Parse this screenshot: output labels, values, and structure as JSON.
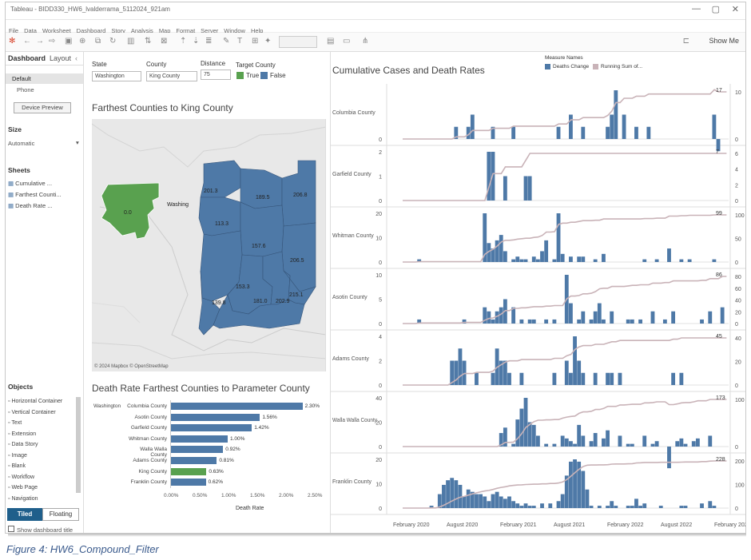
{
  "window": {
    "title": "Tableau - BIDD330_HW6_lvalderrama_5112024_921am",
    "controls": [
      "—",
      "▢",
      "✕"
    ]
  },
  "menu": [
    "File",
    "Data",
    "Worksheet",
    "Dashboard",
    "Story",
    "Analysis",
    "Map",
    "Format",
    "Server",
    "Window",
    "Help"
  ],
  "toolbar": {
    "show_me": "Show Me"
  },
  "left": {
    "tabs": [
      "Dashboard",
      "Layout"
    ],
    "devices": [
      "Default",
      "Phone"
    ],
    "device_preview": "Device Preview",
    "size_head": "Size",
    "size_value": "Automatic",
    "sheets_head": "Sheets",
    "sheets": [
      "Cumulative ...",
      "Farthest Counti...",
      "Death Rate ..."
    ],
    "objects_head": "Objects",
    "objects": [
      "Horizontal Container",
      "Vertical Container",
      "Text",
      "Extension",
      "Data Story",
      "Image",
      "Blank",
      "Workflow",
      "Web Page",
      "Navigation"
    ],
    "tiled": "Tiled",
    "floating": "Floating",
    "show_title": "Show dashboard title"
  },
  "filters": {
    "state_label": "State",
    "state_value": "Washington",
    "county_label": "County",
    "county_value": "King County",
    "distance_label": "Distance",
    "distance_value": "75",
    "target_label": "Target County",
    "true_label": "True",
    "false_label": "False"
  },
  "colors": {
    "blue": "#4e79a7",
    "green": "#59a14f",
    "line": "#c9b3b8"
  },
  "map": {
    "title": "Farthest Counties to King County",
    "attribution": "© 2024 Mapbox © OpenStreetMap",
    "city_label": "Washing",
    "values": [
      "0.0",
      "201.3",
      "189.5",
      "206.8",
      "113.3",
      "157.6",
      "206.5",
      "153.3",
      "139.8",
      "181.0",
      "202.9",
      "215.1"
    ]
  },
  "bar_chart": {
    "title": "Death Rate Farthest Counties to Parameter County",
    "state": "Washington",
    "xlabel": "Death Rate",
    "ticks": [
      "0.00%",
      "0.50%",
      "1.00%",
      "1.50%",
      "2.00%",
      "2.50%"
    ],
    "rows": [
      {
        "county": "Columbia County",
        "value": 2.3,
        "label": "2.30%",
        "target": false
      },
      {
        "county": "Asotin County",
        "value": 1.56,
        "label": "1.56%",
        "target": false
      },
      {
        "county": "Garfield County",
        "value": 1.42,
        "label": "1.42%",
        "target": false
      },
      {
        "county": "Whitman County",
        "value": 1.0,
        "label": "1.00%",
        "target": false
      },
      {
        "county": "Walla Walla County",
        "value": 0.92,
        "label": "0.92%",
        "target": false
      },
      {
        "county": "Adams County",
        "value": 0.81,
        "label": "0.81%",
        "target": false
      },
      {
        "county": "King County",
        "value": 0.63,
        "label": "0.63%",
        "target": true
      },
      {
        "county": "Franklin County",
        "value": 0.62,
        "label": "0.62%",
        "target": false
      }
    ]
  },
  "chart_data": {
    "type": "bar",
    "title": "Cumulative Cases and Death Rates",
    "legend_title": "Measure Names",
    "legend": [
      "Deaths Change",
      "Running Sum of..."
    ],
    "x_ticks": [
      "February 2020",
      "August 2020",
      "February 2021",
      "August 2021",
      "February 2022",
      "August 2022",
      "February 2023"
    ],
    "panels": [
      {
        "county": "Columbia County",
        "left_ticks": [
          "0"
        ],
        "right_ticks": [
          "10",
          "0"
        ],
        "right_max": 20,
        "end_label": "17",
        "bars": [
          0,
          0,
          0,
          0,
          0,
          0,
          0,
          0,
          0,
          0,
          0,
          1,
          0,
          0,
          1,
          2,
          0,
          0,
          0,
          0,
          1,
          0,
          0,
          0,
          0,
          1,
          0,
          0,
          0,
          0,
          0,
          0,
          0,
          0,
          0,
          0,
          1,
          0,
          0,
          2,
          0,
          0,
          1,
          0,
          0,
          0,
          0,
          0,
          1,
          2,
          4,
          0,
          2,
          0,
          0,
          1,
          0,
          0,
          1,
          0,
          0,
          0,
          0,
          0,
          0,
          0,
          0,
          0,
          0,
          0,
          0,
          0,
          0,
          0,
          2,
          -1,
          0,
          0
        ]
      },
      {
        "county": "Garfield County",
        "left_ticks": [
          "2",
          "1",
          "0"
        ],
        "right_ticks": [
          "6",
          "4",
          "2",
          "0"
        ],
        "right_max": 7,
        "end_label": "7",
        "bars": [
          0,
          0,
          0,
          0,
          0,
          0,
          0,
          0,
          0,
          0,
          0,
          0,
          0,
          0,
          0,
          0,
          0,
          0,
          0,
          2,
          2,
          0,
          0,
          1,
          0,
          0,
          0,
          0,
          1,
          1,
          0,
          0,
          0,
          0,
          0,
          0,
          0,
          0,
          0,
          0,
          0,
          0,
          0,
          0,
          0,
          0,
          0,
          0,
          0,
          0,
          0,
          0,
          0,
          0,
          0,
          0,
          0,
          0,
          0,
          0,
          0,
          0,
          0,
          0,
          0,
          0,
          0,
          0,
          0,
          0,
          0,
          0,
          0,
          0,
          0,
          0,
          0,
          0
        ]
      },
      {
        "county": "Whitman County",
        "left_ticks": [
          "20",
          "10",
          "0"
        ],
        "right_ticks": [
          "100",
          "50",
          "0"
        ],
        "right_max": 100,
        "end_label": "99",
        "bars": [
          0,
          0,
          1,
          0,
          0,
          0,
          0,
          0,
          0,
          0,
          0,
          0,
          0,
          0,
          0,
          0,
          0,
          0,
          18,
          7,
          5,
          8,
          10,
          4,
          0,
          1,
          2,
          1,
          1,
          0,
          2,
          1,
          4,
          8,
          0,
          1,
          18,
          3,
          0,
          2,
          0,
          2,
          2,
          0,
          0,
          1,
          0,
          3,
          0,
          0,
          0,
          0,
          0,
          0,
          0,
          0,
          0,
          1,
          0,
          0,
          1,
          0,
          0,
          5,
          0,
          0,
          1,
          0,
          1,
          0,
          0,
          0,
          0,
          0,
          1,
          0,
          0,
          0
        ]
      },
      {
        "county": "Asotin County",
        "left_ticks": [
          "10",
          "5",
          "0"
        ],
        "right_ticks": [
          "80",
          "60",
          "40",
          "20",
          "0"
        ],
        "right_max": 90,
        "end_label": "86",
        "bars": [
          0,
          0,
          1,
          0,
          0,
          0,
          0,
          0,
          0,
          0,
          0,
          0,
          0,
          1,
          0,
          0,
          0,
          0,
          4,
          3,
          1,
          3,
          4,
          6,
          0,
          4,
          0,
          1,
          0,
          1,
          1,
          0,
          0,
          1,
          0,
          1,
          0,
          0,
          12,
          5,
          0,
          1,
          3,
          0,
          1,
          3,
          5,
          1,
          0,
          3,
          0,
          0,
          0,
          1,
          1,
          0,
          1,
          0,
          0,
          3,
          0,
          0,
          1,
          0,
          3,
          0,
          0,
          0,
          0,
          0,
          0,
          1,
          0,
          3,
          0,
          0,
          4,
          0
        ]
      },
      {
        "county": "Adams County",
        "left_ticks": [
          "4",
          "2",
          "0"
        ],
        "right_ticks": [
          "40",
          "20",
          "0"
        ],
        "right_max": 46,
        "end_label": "45",
        "bars": [
          0,
          0,
          0,
          0,
          0,
          0,
          0,
          0,
          0,
          0,
          2,
          2,
          3,
          2,
          0,
          0,
          1,
          0,
          0,
          0,
          1,
          3,
          2,
          2,
          1,
          0,
          0,
          1,
          0,
          0,
          0,
          0,
          0,
          0,
          0,
          1,
          0,
          0,
          2,
          1,
          4,
          2,
          1,
          0,
          0,
          1,
          0,
          0,
          1,
          1,
          0,
          1,
          0,
          0,
          0,
          0,
          0,
          0,
          0,
          0,
          0,
          0,
          0,
          0,
          1,
          0,
          1,
          0,
          0,
          0,
          0,
          0,
          0,
          0,
          0,
          0,
          0,
          0
        ]
      },
      {
        "county": "Walla Walla County",
        "left_ticks": [
          "40",
          "20",
          "0"
        ],
        "right_ticks": [
          "100",
          "0"
        ],
        "right_max": 175,
        "end_label": "173",
        "bars": [
          0,
          0,
          0,
          0,
          0,
          0,
          0,
          0,
          0,
          0,
          0,
          0,
          0,
          0,
          0,
          0,
          0,
          0,
          0,
          0,
          0,
          0,
          5,
          7,
          0,
          1,
          10,
          14,
          18,
          9,
          8,
          4,
          0,
          1,
          0,
          1,
          0,
          4,
          3,
          2,
          1,
          8,
          4,
          0,
          2,
          5,
          0,
          3,
          6,
          0,
          0,
          4,
          0,
          1,
          1,
          0,
          0,
          4,
          0,
          1,
          2,
          0,
          0,
          -8,
          0,
          2,
          3,
          1,
          0,
          2,
          3,
          0,
          0,
          4,
          0,
          0,
          0,
          0
        ]
      },
      {
        "county": "Franklin County",
        "left_ticks": [
          "20",
          "10",
          "0"
        ],
        "right_ticks": [
          "200",
          "100",
          "0"
        ],
        "right_max": 230,
        "end_label": "228",
        "bars": [
          0,
          0,
          0,
          0,
          0,
          1,
          0,
          6,
          10,
          12,
          13,
          12,
          10,
          5,
          8,
          7,
          6,
          6,
          5,
          3,
          6,
          7,
          5,
          4,
          5,
          3,
          2,
          1,
          2,
          1,
          1,
          0,
          2,
          0,
          2,
          0,
          3,
          6,
          14,
          20,
          21,
          20,
          16,
          8,
          1,
          0,
          1,
          0,
          1,
          3,
          1,
          0,
          0,
          1,
          1,
          4,
          1,
          2,
          0,
          0,
          0,
          1,
          0,
          0,
          0,
          0,
          1,
          1,
          0,
          0,
          0,
          2,
          0,
          3,
          1,
          0,
          0,
          0
        ]
      }
    ]
  },
  "figure_caption": "Figure 4: HW6_Compound_Filter"
}
